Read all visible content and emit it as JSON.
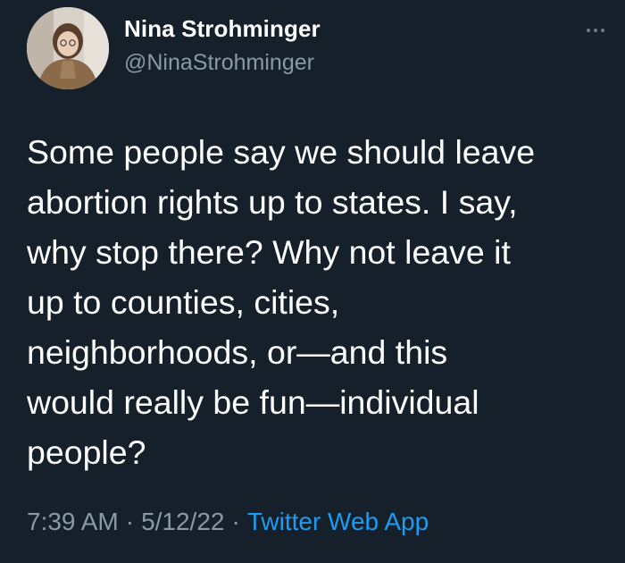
{
  "tweet": {
    "author": {
      "display_name": "Nina Strohminger",
      "handle": "@NinaStrohminger",
      "avatar_icon": "profile-photo"
    },
    "more_icon": "more-horizontal-icon",
    "text_lines": [
      "Some people say we should leave",
      "abortion rights up to states. I say,",
      "why stop there? Why not leave it",
      "up to counties, cities,",
      "neighborhoods, or—and this",
      "would really be fun—individual",
      "people?"
    ],
    "meta": {
      "time": "7:39 AM",
      "separator": "·",
      "date": "5/12/22",
      "source": "Twitter Web App"
    }
  },
  "colors": {
    "background": "#15202b",
    "text": "#ffffff",
    "secondary": "#8b98a5",
    "link": "#1d9bf0"
  }
}
